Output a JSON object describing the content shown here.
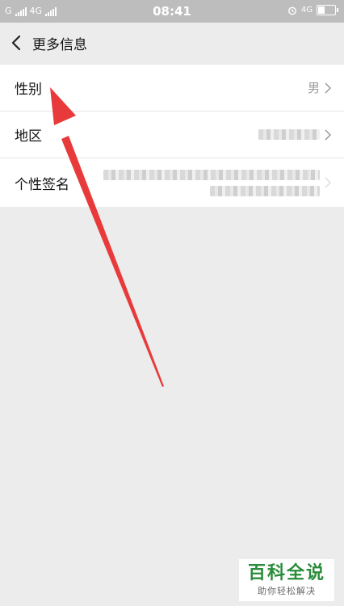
{
  "status_bar": {
    "carrier1": "G",
    "carrier2": "4G",
    "time": "08:41",
    "network": "4G"
  },
  "header": {
    "back_icon": "chevron-left-icon",
    "title": "更多信息"
  },
  "rows": [
    {
      "label": "性别",
      "value": "男"
    },
    {
      "label": "地区",
      "value": ""
    },
    {
      "label": "个性签名",
      "value": ""
    }
  ],
  "watermark": {
    "main": "百科全说",
    "sub": "助你轻松解决"
  },
  "colors": {
    "status_bar": "#bdbdbd",
    "background": "#ececec",
    "annotation_arrow": "#e83a3a",
    "watermark_green": "#2a8c3a"
  }
}
